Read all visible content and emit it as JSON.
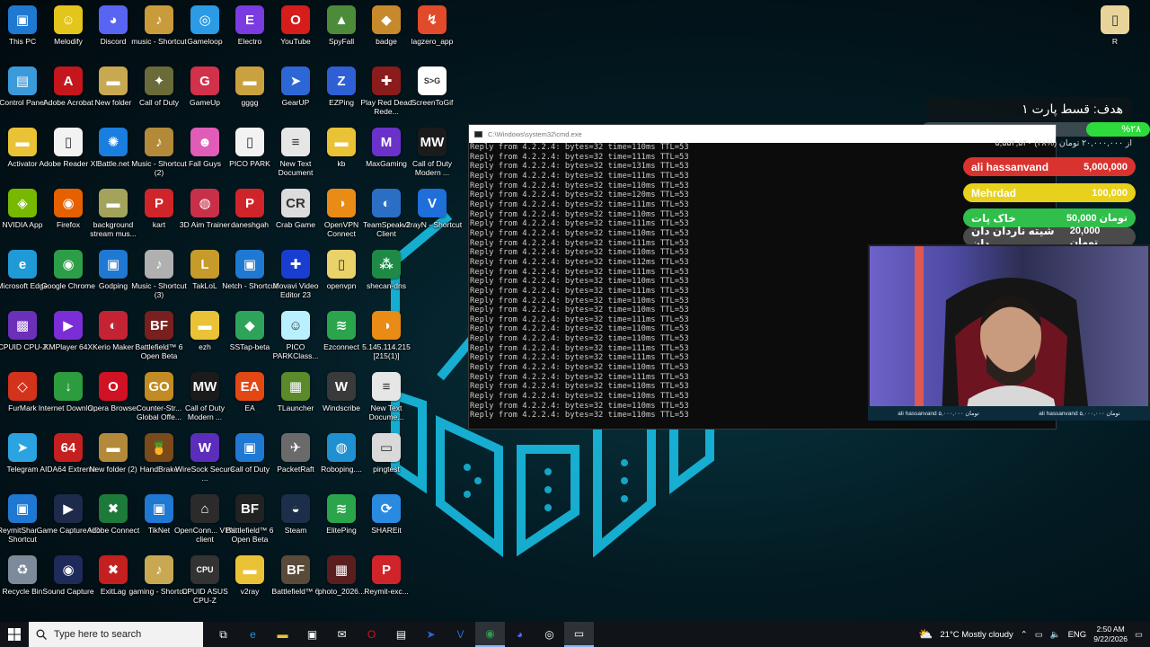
{
  "desktop": {
    "icons": [
      {
        "label": "This PC",
        "glyph": "▣",
        "color": "#1f78d1"
      },
      {
        "label": "Melodify",
        "glyph": "☺",
        "color": "#e3c51b"
      },
      {
        "label": "Discord",
        "glyph": "◕",
        "color": "#5865f2"
      },
      {
        "label": "music - Shortcut",
        "glyph": "♪",
        "color": "#c99b3b"
      },
      {
        "label": "Gameloop",
        "glyph": "◎",
        "color": "#2b9be6"
      },
      {
        "label": "Electro",
        "glyph": "E",
        "color": "#7a3be0"
      },
      {
        "label": "YouTube",
        "glyph": "O",
        "color": "#d71c1c"
      },
      {
        "label": "SpyFall",
        "glyph": "▲",
        "color": "#4c8b3a"
      },
      {
        "label": "badge",
        "glyph": "◆",
        "color": "#c68a2c"
      },
      {
        "label": "lagzero_app",
        "glyph": "↯",
        "color": "#e14a2a"
      },
      {
        "label": "Control Panel",
        "glyph": "▤",
        "color": "#3b9ad9"
      },
      {
        "label": "Adobe Acrobat",
        "glyph": "A",
        "color": "#c4161c"
      },
      {
        "label": "New folder",
        "glyph": "▬",
        "color": "#c8a951"
      },
      {
        "label": "Call of Duty",
        "glyph": "✦",
        "color": "#6b6b3a"
      },
      {
        "label": "GameUp",
        "glyph": "G",
        "color": "#d1314a"
      },
      {
        "label": "gggg",
        "glyph": "▬",
        "color": "#c9a13f"
      },
      {
        "label": "GearUP",
        "glyph": "➤",
        "color": "#2d67d6"
      },
      {
        "label": "EZPing",
        "glyph": "Z",
        "color": "#2f5fd4"
      },
      {
        "label": "Play Red Dead Rede...",
        "glyph": "✚",
        "color": "#8a1c1c"
      },
      {
        "label": "ScreenToGif",
        "glyph": "S>G",
        "color": "#ffffff"
      },
      {
        "label": "Activator",
        "glyph": "▬",
        "color": "#e9c335"
      },
      {
        "label": "Adobe Reader XI",
        "glyph": "▯",
        "color": "#f2f2f2"
      },
      {
        "label": "Battle.net",
        "glyph": "✺",
        "color": "#1a7de0"
      },
      {
        "label": "Music - Shortcut (2)",
        "glyph": "♪",
        "color": "#b38a3a"
      },
      {
        "label": "Fall Guys",
        "glyph": "☻",
        "color": "#e05cb7"
      },
      {
        "label": "PICO PARK",
        "glyph": "▯",
        "color": "#f2f2f2"
      },
      {
        "label": "New Text Document",
        "glyph": "≡",
        "color": "#e6e6e6"
      },
      {
        "label": "kb",
        "glyph": "▬",
        "color": "#e9c335"
      },
      {
        "label": "MaxGaming",
        "glyph": "M",
        "color": "#6a32c9"
      },
      {
        "label": "Call of Duty Modern ...",
        "glyph": "MW",
        "color": "#1b1b1b"
      },
      {
        "label": "NVIDIA App",
        "glyph": "◈",
        "color": "#76b900"
      },
      {
        "label": "Firefox",
        "glyph": "◉",
        "color": "#e66000"
      },
      {
        "label": "background stream mus...",
        "glyph": "▬",
        "color": "#a3a35c"
      },
      {
        "label": "kart",
        "glyph": "P",
        "color": "#d0242b"
      },
      {
        "label": "3D Aim Trainer",
        "glyph": "◍",
        "color": "#c8304a"
      },
      {
        "label": "daneshgah",
        "glyph": "P",
        "color": "#d0242b"
      },
      {
        "label": "Crab Game",
        "glyph": "CR",
        "color": "#dcdcdc"
      },
      {
        "label": "OpenVPN Connect",
        "glyph": "◑",
        "color": "#e98b14"
      },
      {
        "label": "TeamSpeak 3 Client",
        "glyph": "◐",
        "color": "#2b6fc4"
      },
      {
        "label": "v2rayN - Shortcut",
        "glyph": "V",
        "color": "#1e6fd9"
      },
      {
        "label": "Microsoft Edge",
        "glyph": "e",
        "color": "#1f9ad6"
      },
      {
        "label": "Google Chrome",
        "glyph": "◉",
        "color": "#2d9e48"
      },
      {
        "label": "Godping",
        "glyph": "▣",
        "color": "#1f78d1"
      },
      {
        "label": "Music - Shortcut (3)",
        "glyph": "♪",
        "color": "#b0b0b0"
      },
      {
        "label": "TakLoL",
        "glyph": "L",
        "color": "#c69b2a"
      },
      {
        "label": "Netch - Shortcut",
        "glyph": "▣",
        "color": "#1f78d1"
      },
      {
        "label": "Movavi Video Editor 23",
        "glyph": "✚",
        "color": "#1a3dd1"
      },
      {
        "label": "openvpn",
        "glyph": "▯",
        "color": "#e9d26a"
      },
      {
        "label": "shecan-dns",
        "glyph": "⁂",
        "color": "#1e8a45"
      },
      {
        "label": "CPUID CPU-Z",
        "glyph": "▩",
        "color": "#6b2fb8"
      },
      {
        "label": "KMPlayer 64X",
        "glyph": "▶",
        "color": "#7b2dd6"
      },
      {
        "label": "Kerio Maker",
        "glyph": "◐",
        "color": "#c42334"
      },
      {
        "label": "Battlefield™ 6 Open Beta",
        "glyph": "BF",
        "color": "#7a1f1f"
      },
      {
        "label": "ezh",
        "glyph": "▬",
        "color": "#e9c335"
      },
      {
        "label": "SSTap-beta",
        "glyph": "◆",
        "color": "#2ea35a"
      },
      {
        "label": "PICO PARKClass...",
        "glyph": "☺",
        "color": "#b9f0ff"
      },
      {
        "label": "Ezconnect",
        "glyph": "≋",
        "color": "#2aa54b"
      },
      {
        "label": "5.145.114.215 [215(1)]",
        "glyph": "◑",
        "color": "#e98b14"
      },
      {
        "label": "FurMark",
        "glyph": "◇",
        "color": "#d3321b"
      },
      {
        "label": "Internet Downlo...",
        "glyph": "↓",
        "color": "#2c9c3f"
      },
      {
        "label": "Opera Browser",
        "glyph": "O",
        "color": "#d11224"
      },
      {
        "label": "Counter-Str... Global Offe...",
        "glyph": "GO",
        "color": "#c28b24"
      },
      {
        "label": "Call of Duty Modern ...",
        "glyph": "MW",
        "color": "#1b1b1b"
      },
      {
        "label": "EA",
        "glyph": "EA",
        "color": "#e34814"
      },
      {
        "label": "TLauncher",
        "glyph": "▦",
        "color": "#5a8a2a"
      },
      {
        "label": "Windscribe",
        "glyph": "W",
        "color": "#3a3a3a"
      },
      {
        "label": "New Text Docume...",
        "glyph": "≡",
        "color": "#e6e6e6"
      },
      {
        "label": "Telegram",
        "glyph": "➤",
        "color": "#2aa3e0"
      },
      {
        "label": "AIDA64 Extreme",
        "glyph": "64",
        "color": "#c42020"
      },
      {
        "label": "New folder (2)",
        "glyph": "▬",
        "color": "#b38a3a"
      },
      {
        "label": "HandBrake",
        "glyph": "🍍",
        "color": "#7a4a1a"
      },
      {
        "label": "WireSock Secure ...",
        "glyph": "W",
        "color": "#5b2dbb"
      },
      {
        "label": "Call of Duty",
        "glyph": "▣",
        "color": "#1f78d1"
      },
      {
        "label": "PacketRaft",
        "glyph": "✈",
        "color": "#6a6a6a"
      },
      {
        "label": "Roboping....",
        "glyph": "◍",
        "color": "#1f90d1"
      },
      {
        "label": "pingtest",
        "glyph": "▭",
        "color": "#d9d9d9"
      },
      {
        "label": "ReymitShar... - Shortcut",
        "glyph": "▣",
        "color": "#1f78d1"
      },
      {
        "label": "Game Capture HD",
        "glyph": "▶",
        "color": "#1e2a4a"
      },
      {
        "label": "Adobe Connect",
        "glyph": "✖",
        "color": "#1d7a3a"
      },
      {
        "label": "TikNet",
        "glyph": "▣",
        "color": "#1f78d1"
      },
      {
        "label": "OpenConn... VPN client",
        "glyph": "⌂",
        "color": "#2b2b2b"
      },
      {
        "label": "Battlefield™ 6 Open Beta",
        "glyph": "BF",
        "color": "#222222"
      },
      {
        "label": "Steam",
        "glyph": "◒",
        "color": "#1b2f4a"
      },
      {
        "label": "ElitePing",
        "glyph": "≋",
        "color": "#2aa54b"
      },
      {
        "label": "SHAREit",
        "glyph": "⟳",
        "color": "#2a8ae0"
      },
      {
        "label": "Recycle Bin",
        "glyph": "♻",
        "color": "#7c8a99"
      },
      {
        "label": "Sound Capture",
        "glyph": "◉",
        "color": "#1e2a5a"
      },
      {
        "label": "ExitLag",
        "glyph": "✖",
        "color": "#c42020"
      },
      {
        "label": "gaming - Shortcut",
        "glyph": "♪",
        "color": "#c8a951"
      },
      {
        "label": "CPUID ASUS CPU-Z",
        "glyph": "CPU",
        "color": "#333333"
      },
      {
        "label": "v2ray",
        "glyph": "▬",
        "color": "#e9c335"
      },
      {
        "label": "Battlefield™ 6",
        "glyph": "BF",
        "color": "#5a4a3a"
      },
      {
        "label": "photo_2026...",
        "glyph": "▦",
        "color": "#5a1e1e"
      },
      {
        "label": "Reymit-exc...",
        "glyph": "P",
        "color": "#d0242b"
      },
      {
        "label": "R",
        "glyph": "▯",
        "color": "#e8d49a"
      }
    ]
  },
  "cmd": {
    "title": "C:\\Windows\\system32\\cmd.exe",
    "lines": [
      "Reply from 4.2.2.4: bytes=32 time=110ms TTL=53",
      "Reply from 4.2.2.4: bytes=32 time=111ms TTL=53",
      "Reply from 4.2.2.4: bytes=32 time=131ms TTL=53",
      "Reply from 4.2.2.4: bytes=32 time=111ms TTL=53",
      "Reply from 4.2.2.4: bytes=32 time=110ms TTL=53",
      "Reply from 4.2.2.4: bytes=32 time=120ms TTL=53",
      "Reply from 4.2.2.4: bytes=32 time=111ms TTL=53",
      "Reply from 4.2.2.4: bytes=32 time=110ms TTL=53",
      "Reply from 4.2.2.4: bytes=32 time=111ms TTL=53",
      "Reply from 4.2.2.4: bytes=32 time=110ms TTL=53",
      "Reply from 4.2.2.4: bytes=32 time=111ms TTL=53",
      "Reply from 4.2.2.4: bytes=32 time=110ms TTL=53",
      "Reply from 4.2.2.4: bytes=32 time=112ms TTL=53",
      "Reply from 4.2.2.4: bytes=32 time=111ms TTL=53",
      "Reply from 4.2.2.4: bytes=32 time=110ms TTL=53",
      "Reply from 4.2.2.4: bytes=32 time=111ms TTL=53",
      "Reply from 4.2.2.4: bytes=32 time=110ms TTL=53",
      "Reply from 4.2.2.4: bytes=32 time=110ms TTL=53",
      "Reply from 4.2.2.4: bytes=32 time=111ms TTL=53",
      "Reply from 4.2.2.4: bytes=32 time=110ms TTL=53",
      "Reply from 4.2.2.4: bytes=32 time=110ms TTL=53",
      "Reply from 4.2.2.4: bytes=32 time=111ms TTL=53",
      "Reply from 4.2.2.4: bytes=32 time=111ms TTL=53",
      "Reply from 4.2.2.4: bytes=32 time=110ms TTL=53",
      "Reply from 4.2.2.4: bytes=32 time=111ms TTL=53",
      "Reply from 4.2.2.4: bytes=32 time=110ms TTL=53",
      "Reply from 4.2.2.4: bytes=32 time=110ms TTL=53",
      "Reply from 4.2.2.4: bytes=32 time=110ms TTL=53",
      "Reply from 4.2.2.4: bytes=32 time=110ms TTL=53"
    ]
  },
  "overlay": {
    "goal_title": "هدف: قسط پارت ۱",
    "goal_percent_label": "%۲۸",
    "goal_progress": 0.28,
    "goal_amount": "۵,۵۵۴,۵۴۰ از ۲۰,۰۰۰,۰۰۰ تومان (%۲۸)",
    "donors": [
      {
        "name": "ali hassanvand",
        "amount": "5,000,000",
        "color": "#d8332f"
      },
      {
        "name": "Mehrdad",
        "amount": "100,000",
        "color": "#e7d11c"
      },
      {
        "name": "خاک پات",
        "amount": "50,000 تومان",
        "color": "#2fbf4a"
      },
      {
        "name": "شیته ناردان دان دان",
        "amount": "20,000 تومان",
        "color": "#4a4a4a"
      }
    ],
    "strip_left": "ali hassanvand ۵,۰۰۰,۰۰۰ تومان",
    "strip_right": "ali hassanvand ۵,۰۰۰,۰۰۰ تومان"
  },
  "taskbar": {
    "search_placeholder": "Type here to search",
    "weather": "21°C  Mostly cloudy",
    "language": "ENG",
    "time": "2:50 AM",
    "date": "9/22/2026",
    "pinned": [
      "task-view",
      "edge",
      "file-explorer",
      "store",
      "mail",
      "opera",
      "unknown-app",
      "gearup",
      "v2rayn",
      "chrome",
      "discord",
      "obs",
      "cmd"
    ]
  }
}
